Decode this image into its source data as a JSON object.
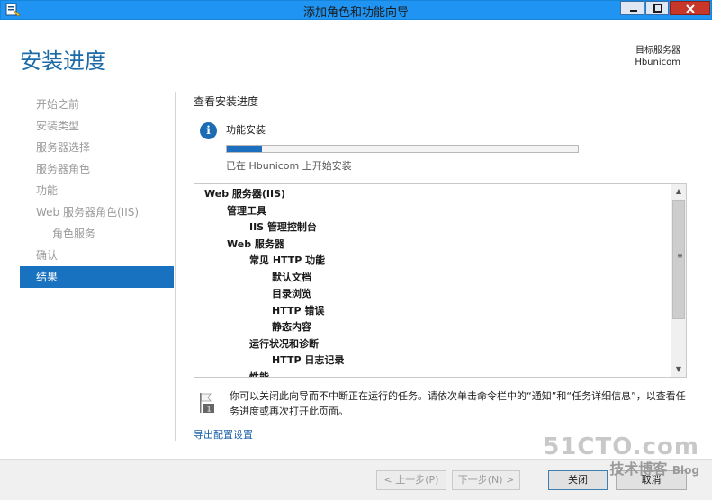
{
  "window": {
    "title": "添加角色和功能向导"
  },
  "header": {
    "page_title": "安装进度",
    "target_label": "目标服务器",
    "target_server": "Hbunicom"
  },
  "nav": {
    "items": [
      {
        "label": "开始之前",
        "state": "disabled"
      },
      {
        "label": "安装类型",
        "state": "disabled"
      },
      {
        "label": "服务器选择",
        "state": "disabled"
      },
      {
        "label": "服务器角色",
        "state": "disabled"
      },
      {
        "label": "功能",
        "state": "disabled"
      },
      {
        "label": "Web 服务器角色(IIS)",
        "state": "disabled"
      },
      {
        "label": "角色服务",
        "state": "disabled"
      },
      {
        "label": "确认",
        "state": "disabled"
      },
      {
        "label": "结果",
        "state": "active"
      }
    ]
  },
  "main": {
    "section_title": "查看安装进度",
    "feature_label": "功能安装",
    "progress_fraction": 0.1,
    "status_text": "已在 Hbunicom 上开始安装",
    "tree": [
      {
        "label": "Web 服务器(IIS)",
        "level": 0
      },
      {
        "label": "管理工具",
        "level": 1
      },
      {
        "label": "IIS 管理控制台",
        "level": 2
      },
      {
        "label": "Web 服务器",
        "level": 1
      },
      {
        "label": "常见 HTTP 功能",
        "level": 2
      },
      {
        "label": "默认文档",
        "level": 3
      },
      {
        "label": "目录浏览",
        "level": 3
      },
      {
        "label": "HTTP 错误",
        "level": 3
      },
      {
        "label": "静态内容",
        "level": 3
      },
      {
        "label": "运行状况和诊断",
        "level": 2
      },
      {
        "label": "HTTP 日志记录",
        "level": 3
      },
      {
        "label": "性能",
        "level": 2
      }
    ],
    "notice_text": "你可以关闭此向导而不中断正在运行的任务。请依次单击命令栏中的“通知”和“任务详细信息”，以查看任务进度或再次打开此页面。",
    "flag_number": "1",
    "export_link": "导出配置设置"
  },
  "footer": {
    "prev_label": "< 上一步(P)",
    "next_label": "下一步(N) >",
    "close_label": "关闭",
    "cancel_label": "取消"
  },
  "watermark": {
    "site": "51CTO.com",
    "tagline": "技术博客",
    "blog": "Blog"
  },
  "colors": {
    "titlebar": "#1f94f2",
    "accent": "#1c6ba8",
    "nav_active": "#1972c0",
    "progress": "#1d6fbf"
  }
}
